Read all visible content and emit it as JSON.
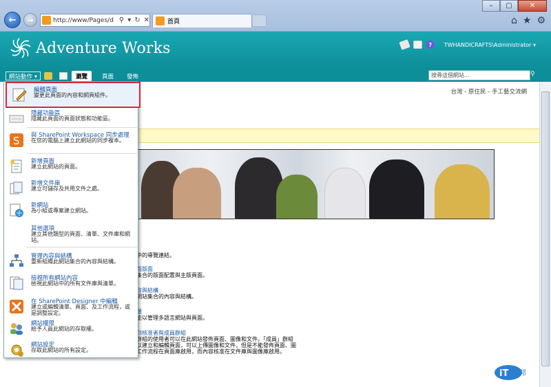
{
  "browser": {
    "address": "http://www/Pages/d",
    "tab_title": "首頁"
  },
  "header": {
    "brand": "Adventure Works",
    "user": "TWHANDICRAFTS\\Administrator ▾"
  },
  "ribbon": {
    "site_actions": "網站動作 ▾",
    "tabs": [
      "瀏覽",
      "頁面",
      "發佈"
    ]
  },
  "search": {
    "placeholder": "搜尋這個網站..."
  },
  "breadcrumb": "台灣 - 原住民 - 手工藝交流網",
  "menu": {
    "items": [
      {
        "title": "編輯頁面",
        "desc": "變更此頁面的內容和網頁組件。",
        "icon": "edit-page-icon",
        "selected": true
      },
      {
        "title": "隱藏功能區",
        "desc": "隱藏此頁面的頁面狀態和功能區。",
        "icon": "hide-ribbon-icon"
      },
      {
        "title": "與 SharePoint Workspace 同步處理",
        "desc": "在您的電腦上建立此網站的同步複本。",
        "icon": "workspace-icon"
      },
      {
        "title": "新增頁面",
        "desc": "建立此網站的頁面。",
        "icon": "new-page-icon"
      },
      {
        "title": "新增文件庫",
        "desc": "建立可儲存及共用文件之處。",
        "icon": "new-library-icon"
      },
      {
        "title": "新網站",
        "desc": "為小組或專案建立網站。",
        "icon": "new-site-icon"
      },
      {
        "title": "其他選項",
        "desc": "建立其他類型的頁面、清單、文件庫和網站。",
        "icon": "more-options-icon"
      },
      {
        "title": "管理內容與結構",
        "desc": "重新組織此網站集合的內容與結構。",
        "icon": "manage-content-icon"
      },
      {
        "title": "檢視所有網站內容",
        "desc": "檢視此網站中的所有文件庫與清單。",
        "icon": "view-content-icon"
      },
      {
        "title": "在 SharePoint Designer 中編輯",
        "desc": "建立或編輯清單、頁面、及工作流程，或是調整設定。",
        "icon": "designer-icon"
      },
      {
        "title": "網站權限",
        "desc": "給予人員此網站的存取權。",
        "icon": "permissions-icon"
      },
      {
        "title": "網站設定",
        "desc": "存取此網站的所有設定。",
        "icon": "settings-icon"
      }
    ]
  },
  "body": {
    "lines": [
      {
        "text": "中的導覽連結。",
        "link": false
      },
      {
        "text": "面版面",
        "link": true
      },
      {
        "text": "集合的版面配置與主版頁面。",
        "link": false
      },
      {
        "text": "容與結構",
        "link": true
      },
      {
        "text": "網站集合的內容與結構。",
        "link": false
      },
      {
        "text": "援",
        "link": true
      },
      {
        "text": "能以管理多語言網站與頁面。",
        "link": false
      },
      {
        "text": "到核准者與成員群組",
        "link": true
      },
      {
        "text": "群組的使用者可以在此網站發佈頁面、圖像和文件。「成員」群組",
        "link": false
      },
      {
        "text": "以建立和編輯頁面，可以上傳圖像和文件，但是不能發佈頁面、圖",
        "link": false
      },
      {
        "text": "工作流程在頁面庫啟用，而內容核准在文件庫與圖像庫啟用。",
        "link": false
      }
    ]
  },
  "watermark": "iT邦幫忙",
  "colors": {
    "accent": "#0d8e99",
    "link": "#1a5aa8",
    "highlight": "#d9263b"
  }
}
